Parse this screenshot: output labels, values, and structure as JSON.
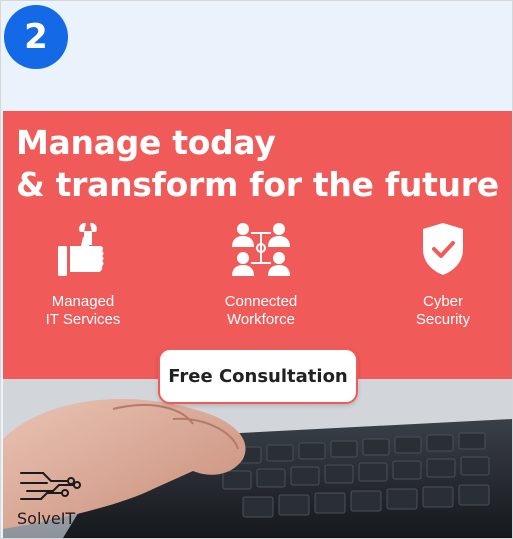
{
  "step_number": "2",
  "headline": {
    "line1": "Manage today",
    "line2": "& transform for the future"
  },
  "features": [
    {
      "icon": "thumbs-up-wrench-icon",
      "line1": "Managed",
      "line2": "IT Services"
    },
    {
      "icon": "connected-people-icon",
      "line1": "Connected",
      "line2": "Workforce"
    },
    {
      "icon": "shield-check-icon",
      "line1": "Cyber",
      "line2": "Security"
    }
  ],
  "cta_label": "Free Consultation",
  "brand_name": "SolveIT",
  "colors": {
    "badge_blue": "#1469e6",
    "banner_red": "#f05a58",
    "page_background": "#eaf3fc"
  }
}
